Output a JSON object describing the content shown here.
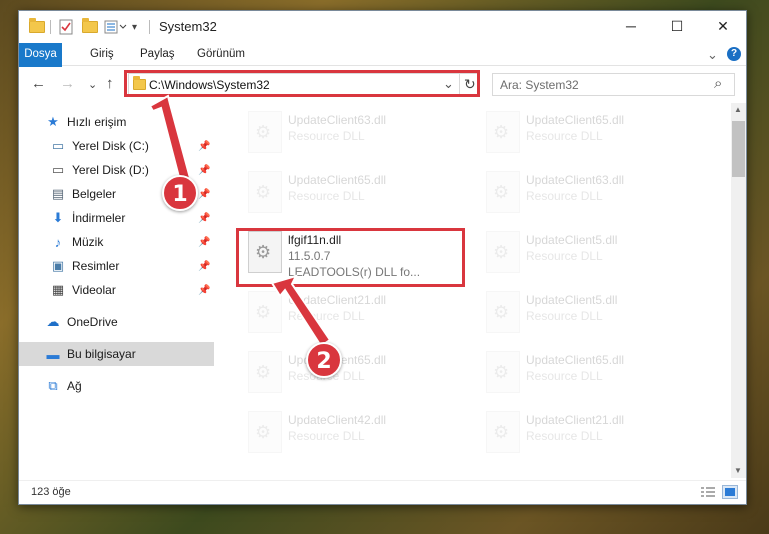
{
  "window": {
    "title": "System32",
    "minimize": "─",
    "maximize": "☐",
    "close": "✕"
  },
  "ribbon": {
    "tabs": [
      "Dosya",
      "Giriş",
      "Paylaş",
      "Görünüm"
    ],
    "expand": "⌄",
    "help": "?"
  },
  "navbar": {
    "back": "←",
    "forward": "→",
    "recent": "⌄",
    "up": "↑",
    "address": "C:\\Windows\\System32",
    "dropdown": "⌄",
    "refresh": "↻",
    "search_placeholder": "Ara: System32",
    "search_icon": "⌕"
  },
  "sidebar": {
    "items": [
      {
        "label": "Hızlı erişim",
        "icon": "star-icon",
        "glyph": "★"
      },
      {
        "label": "Yerel Disk (C:)",
        "icon": "drive-icon",
        "glyph": "▭"
      },
      {
        "label": "Yerel Disk (D:)",
        "icon": "drive-icon",
        "glyph": "▭"
      },
      {
        "label": "Belgeler",
        "icon": "document-icon",
        "glyph": "▤"
      },
      {
        "label": "İndirmeler",
        "icon": "download-icon",
        "glyph": "⬇"
      },
      {
        "label": "Müzik",
        "icon": "music-icon",
        "glyph": "♪"
      },
      {
        "label": "Resimler",
        "icon": "pictures-icon",
        "glyph": "▣"
      },
      {
        "label": "Videolar",
        "icon": "video-icon",
        "glyph": "▦"
      },
      {
        "label": "OneDrive",
        "icon": "cloud-icon",
        "glyph": "☁"
      },
      {
        "label": "Bu bilgisayar",
        "icon": "computer-icon",
        "glyph": "▬"
      },
      {
        "label": "Ağ",
        "icon": "network-icon",
        "glyph": "⧉"
      }
    ],
    "pin": "📌"
  },
  "files": [
    {
      "name": "UpdateClient63.dll",
      "desc": "Resource DLL",
      "sub": ""
    },
    {
      "name": "UpdateClient65.dll",
      "desc": "Resource DLL",
      "sub": ""
    },
    {
      "name": "UpdateClient65.dll",
      "desc": "Resource DLL",
      "sub": ""
    },
    {
      "name": "UpdateClient63.dll",
      "desc": "Resource DLL",
      "sub": ""
    },
    {
      "name": "lfgif11n.dll",
      "desc": "11.5.0.7",
      "sub": "LEADTOOLS(r) DLL fo..."
    },
    {
      "name": "UpdateClient5.dll",
      "desc": "Resource DLL",
      "sub": ""
    },
    {
      "name": "UpdateClient21.dll",
      "desc": "Resource DLL",
      "sub": ""
    },
    {
      "name": "UpdateClient5.dll",
      "desc": "Resource DLL",
      "sub": ""
    },
    {
      "name": "UpdateClient65.dll",
      "desc": "Resource DLL",
      "sub": ""
    },
    {
      "name": "UpdateClient65.dll",
      "desc": "Resource DLL",
      "sub": ""
    },
    {
      "name": "UpdateClient42.dll",
      "desc": "Resource DLL",
      "sub": ""
    },
    {
      "name": "UpdateClient21.dll",
      "desc": "Resource DLL",
      "sub": ""
    }
  ],
  "status": {
    "count": "123 öğe"
  },
  "callouts": {
    "one": "1",
    "two": "2",
    "color": "#d9363e"
  }
}
